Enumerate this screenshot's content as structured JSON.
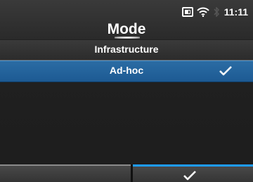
{
  "header": {
    "title": "Mode",
    "status": {
      "time": "11:11",
      "icons": [
        "sd-card-icon",
        "wifi-icon",
        "bluetooth-icon"
      ]
    }
  },
  "list": {
    "items": [
      {
        "label": "Infrastructure",
        "selected": false
      },
      {
        "label": "Ad-hoc",
        "selected": true
      }
    ]
  },
  "footer": {
    "left_icon": "none",
    "right_icon": "checkmark-icon"
  },
  "colors": {
    "accent": "#1e9cff",
    "selected_row": "#235f98",
    "background": "#222222"
  }
}
